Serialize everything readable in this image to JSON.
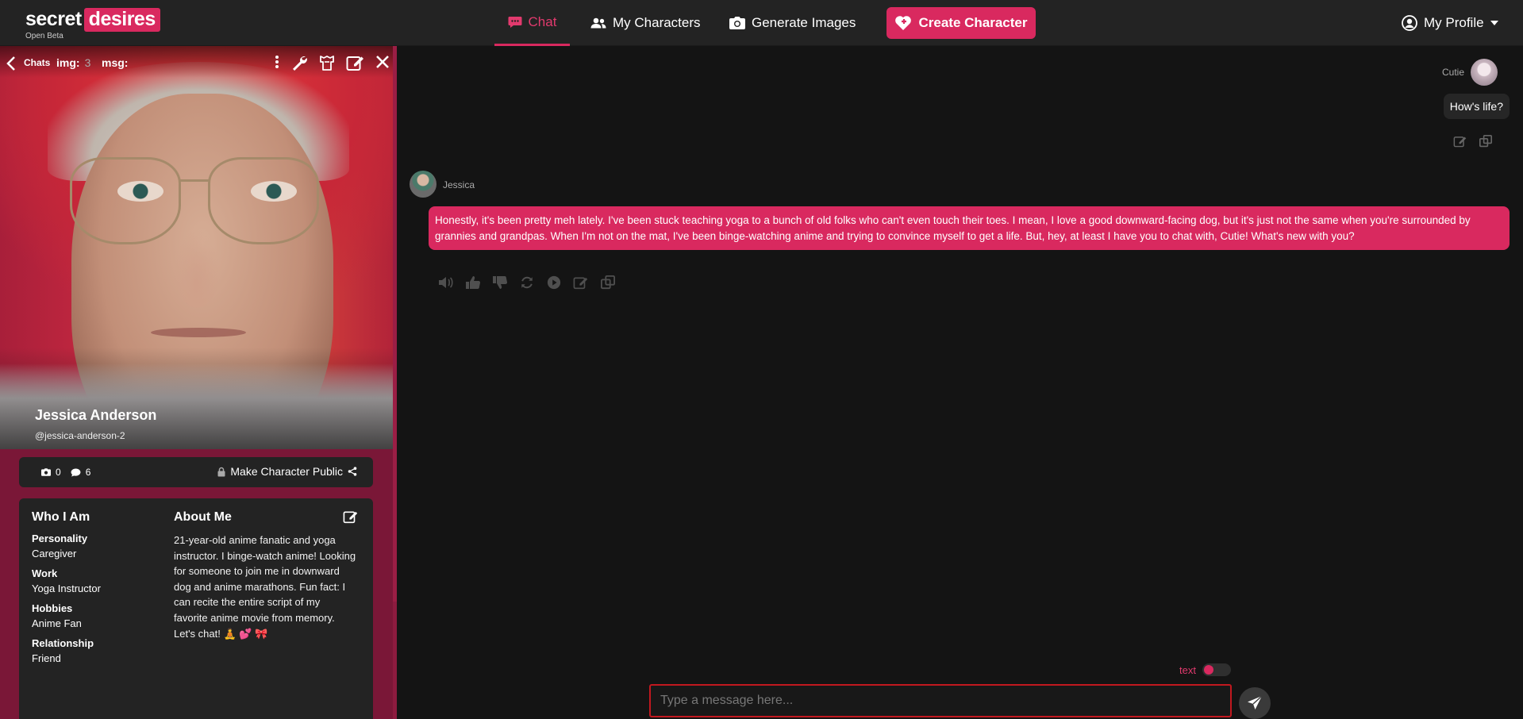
{
  "brand": {
    "word1": "secret",
    "word2": "desires",
    "tagline": "Open Beta"
  },
  "nav": {
    "chat": "Chat",
    "my_characters": "My Characters",
    "generate_images": "Generate Images",
    "create_character": "Create Character",
    "profile": "My Profile"
  },
  "panel": {
    "chats_label": "Chats",
    "img_label": "img:",
    "img_value": "3",
    "msg_label": "msg:",
    "character_name": "Jessica Anderson",
    "handle": "@jessica-anderson-2",
    "stats": {
      "images": "0",
      "messages": "6"
    },
    "make_public": "Make Character Public",
    "who_title": "Who I Am",
    "about_title": "About Me",
    "fields": [
      {
        "label": "Personality",
        "value": "Caregiver"
      },
      {
        "label": "Work",
        "value": "Yoga Instructor"
      },
      {
        "label": "Hobbies",
        "value": "Anime Fan"
      },
      {
        "label": "Relationship",
        "value": "Friend"
      }
    ],
    "about_text": "21-year-old anime fanatic and yoga instructor. I binge-watch anime! Looking for someone to join me in downward dog and anime marathons. Fun fact: I can recite the entire script of my favorite anime movie from memory. Let's chat! 🧘 💕 🎀"
  },
  "chat": {
    "user_name": "Cutie",
    "user_message": "How's life?",
    "bot_name": "Jessica",
    "bot_message": "Honestly, it's been pretty meh lately. I've been stuck teaching yoga to a bunch of old folks who can't even touch their toes. I mean, I love a good downward-facing dog, but it's just not the same when you're surrounded by grannies and grandpas. When I'm not on the mat, I've been binge-watching anime and trying to convince myself to get a life. But, hey, at least I have you to chat with, Cutie! What's new with you?",
    "toggle_label": "text",
    "input_placeholder": "Type a message here..."
  },
  "colors": {
    "accent": "#d9295f",
    "panel_bg": "#7a1737",
    "bg": "#141414",
    "input_border": "#c1181f"
  },
  "icons": [
    "chat-icon",
    "users-icon",
    "camera-icon",
    "heart-plus-icon",
    "user-circle-icon",
    "caret-down-icon",
    "chevron-left-icon",
    "kebab-icon",
    "wrench-icon",
    "hanger-icon",
    "edit-icon",
    "close-icon",
    "camera-small-icon",
    "comment-icon",
    "lock-icon",
    "share-icon",
    "speaker-icon",
    "thumbs-up-icon",
    "thumbs-down-icon",
    "refresh-icon",
    "play-icon",
    "copy-icon",
    "send-icon"
  ]
}
